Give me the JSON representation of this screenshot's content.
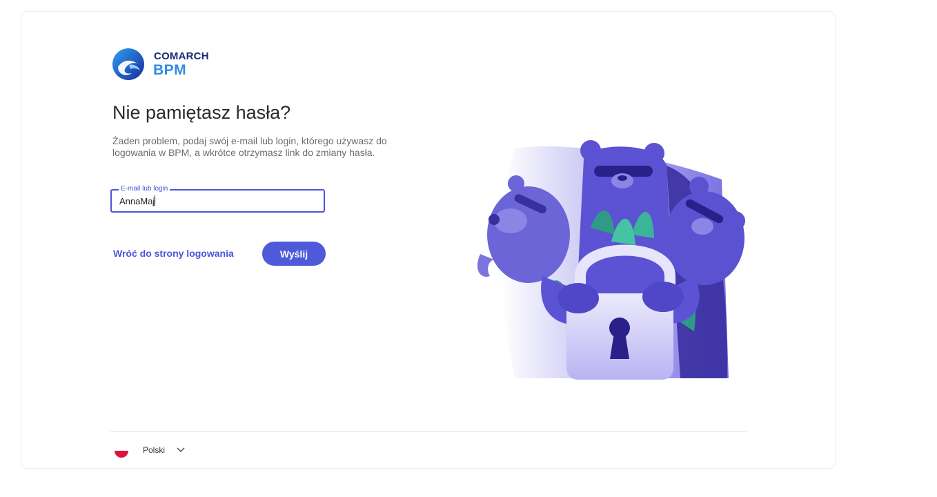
{
  "logo": {
    "company": "COMARCH",
    "product": "BPM"
  },
  "page": {
    "title": "Nie pamiętasz hasła?",
    "description": "Żaden problem, podaj swój e-mail lub login, którego używasz do logowania w BPM, a wkrótce otrzymasz link do zmiany hasła."
  },
  "form": {
    "field_label": "E-mail lub login",
    "field_value": "AnnaMaj",
    "back_link": "Wróć do strony logowania",
    "submit_label": "Wyślij"
  },
  "footer": {
    "language": "Polski",
    "flag_icon": "poland-flag-icon",
    "chevron_icon": "chevron-down-icon"
  },
  "colors": {
    "accent": "#4e5ad9",
    "logo_dark": "#1a2a78",
    "logo_light": "#2f8be6"
  }
}
